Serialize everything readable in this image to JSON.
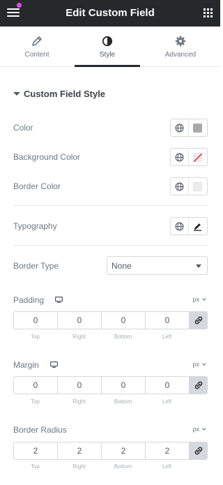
{
  "header": {
    "title": "Edit Custom Field"
  },
  "tabs": [
    {
      "label": "Content",
      "icon": "pencil-icon",
      "active": false
    },
    {
      "label": "Style",
      "icon": "half-circle-icon",
      "active": true
    },
    {
      "label": "Advanced",
      "icon": "gear-icon",
      "active": false
    }
  ],
  "section": {
    "title": "Custom Field Style"
  },
  "colors": {
    "color_label": "Color",
    "color_swatch": "#a9a9a9",
    "background_label": "Background Color",
    "background_swatch": "none",
    "border_label": "Border Color",
    "border_swatch": "#ececec"
  },
  "typography": {
    "label": "Typography"
  },
  "border_type": {
    "label": "Border Type",
    "value": "None"
  },
  "padding": {
    "label": "Padding",
    "unit": "px",
    "values": [
      "0",
      "0",
      "0",
      "0"
    ],
    "sub_labels": [
      "Top",
      "Right",
      "Bottom",
      "Left"
    ]
  },
  "margin": {
    "label": "Margin",
    "unit": "px",
    "values": [
      "0",
      "0",
      "0",
      "0"
    ],
    "sub_labels": [
      "Top",
      "Right",
      "Bottom",
      "Left"
    ]
  },
  "border_radius": {
    "label": "Border Radius",
    "unit": "px",
    "values": [
      "2",
      "2",
      "2",
      "2"
    ],
    "sub_labels": [
      "Top",
      "Right",
      "Bottom",
      "Left"
    ]
  }
}
